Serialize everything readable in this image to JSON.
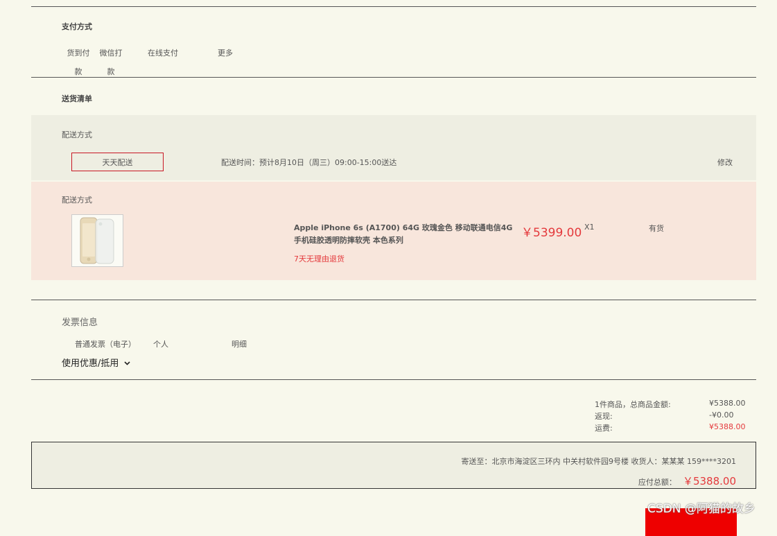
{
  "payment": {
    "title": "支付方式",
    "options": [
      "货到付款",
      "微信打款",
      "在线支付",
      "更多"
    ]
  },
  "delivery_list": {
    "title": "送货清单",
    "method_label": "配送方式",
    "method_button": "天天配送",
    "delivery_time": "配送时间：预计8月10日（周三）09:00-15:00送达",
    "edit": "修改",
    "product_section_label": "配送方式",
    "product": {
      "name": "Apple iPhone 6s (A1700) 64G 玫瑰金色 移动联通电信4G手机硅胶透明防摔软壳 本色系列",
      "price": "￥5399.00",
      "quantity": "X1",
      "stock": "有货",
      "return_policy": "7天无理由退货"
    }
  },
  "invoice": {
    "title": "发票信息",
    "type": "普通发票（电子）",
    "holder": "个人",
    "content": "明细",
    "coupon_toggle": "使用优惠/抵用"
  },
  "totals": {
    "rows": [
      {
        "label": "1件商品，总商品金额:",
        "value": "¥5388.00",
        "highlight": false
      },
      {
        "label": "返现:",
        "value": "-¥0.00",
        "highlight": false
      },
      {
        "label": "运费:",
        "value": "¥5388.00",
        "highlight": true
      }
    ]
  },
  "summary": {
    "address": "寄送至：北京市海淀区三环内 中关村软件园9号楼 收货人：某某某 159****3201",
    "payable_label": "应付总额：",
    "payable_value": "￥5388.00"
  },
  "watermark": "CSDN @阿猫的故乡",
  "colors": {
    "background": "#f8f8ec",
    "accent_red": "#e4393c",
    "button_red": "#ee0000",
    "gray_band": "#eeeee2",
    "pink_band": "#f8e6dc"
  }
}
